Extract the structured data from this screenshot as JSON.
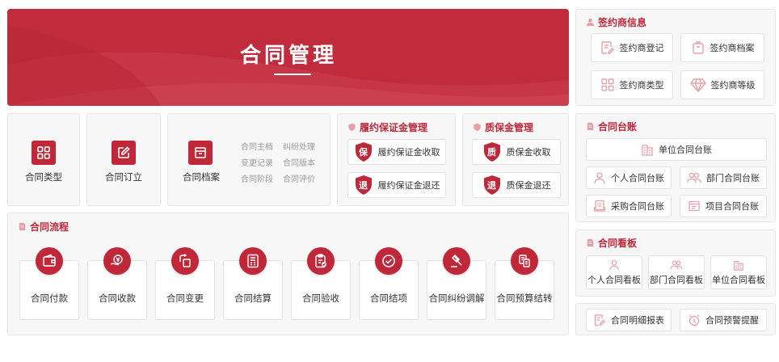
{
  "banner": {
    "title": "合同管理"
  },
  "signer": {
    "title": "签约商信息",
    "buttons": [
      "签约商登记",
      "签约商档案",
      "签约商类型",
      "签约商等级"
    ]
  },
  "contract_cards": {
    "type_label": "合同类型",
    "create_label": "合同订立",
    "archive_label": "合同档案",
    "archive_links": [
      "合同主档",
      "纠纷处理",
      "变更记录",
      "合同版本",
      "合同阶段",
      "合同评价"
    ]
  },
  "performance_bond": {
    "title": "履约保证金管理",
    "badge_collect": "保",
    "badge_refund": "退",
    "collect": "履约保证金收取",
    "refund": "履约保证金退还"
  },
  "warranty": {
    "title": "质保金管理",
    "badge_collect": "质",
    "badge_refund": "退",
    "collect": "质保金收取",
    "refund": "质保金退还"
  },
  "process": {
    "title": "合同流程",
    "items": [
      "合同付款",
      "合同收款",
      "合同变更",
      "合同结算",
      "合同验收",
      "合同结项",
      "合同纠纷调解",
      "合同预算结转"
    ]
  },
  "ledger": {
    "title": "合同台账",
    "unit": "单位合同台账",
    "personal": "个人合同台账",
    "department": "部门合同台账",
    "purchase": "采购合同台账",
    "project": "项目合同台账"
  },
  "board": {
    "title": "合同看板",
    "personal": "个人合同看板",
    "department": "部门合同看板",
    "unit": "单位合同看板"
  },
  "reports": {
    "detail": "合同明细报表",
    "warning": "合同预警提醒"
  },
  "colors": {
    "accent": "#c0283a",
    "panel": "#f7f7f7",
    "icon_pink": "#e8a0a8"
  }
}
